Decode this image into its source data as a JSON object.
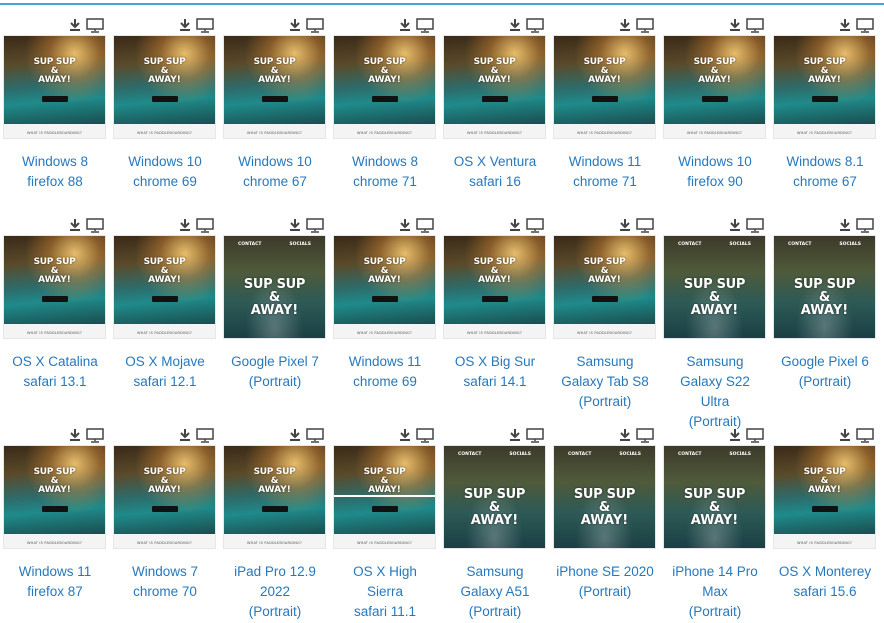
{
  "grid": {
    "hero_line1": "SUP SUP",
    "hero_amp": "&",
    "hero_line2": "AWAY!",
    "strip_text": "WHAT IS PADDLEBOARDING?",
    "nav_contact": "CONTACT",
    "nav_socials": "SOCIALS"
  },
  "rows": [
    [
      {
        "label": "Windows 8\nfirefox 88",
        "portrait": false
      },
      {
        "label": "Windows 10\nchrome 69",
        "portrait": false
      },
      {
        "label": "Windows 10\nchrome 67",
        "portrait": false
      },
      {
        "label": "Windows 8\nchrome 71",
        "portrait": false
      },
      {
        "label": "OS X Ventura\nsafari 16",
        "portrait": false
      },
      {
        "label": "Windows 11\nchrome 71",
        "portrait": false
      },
      {
        "label": "Windows 10\nfirefox 90",
        "portrait": false
      },
      {
        "label": "Windows 8.1\nchrome 67",
        "portrait": false
      }
    ],
    [
      {
        "label": "OS X Catalina\nsafari 13.1",
        "portrait": false
      },
      {
        "label": "OS X Mojave\nsafari 12.1",
        "portrait": false
      },
      {
        "label": "Google Pixel 7\n(Portrait)",
        "portrait": true
      },
      {
        "label": "Windows 11\nchrome 69",
        "portrait": false
      },
      {
        "label": "OS X Big Sur\nsafari 14.1",
        "portrait": false
      },
      {
        "label": "Samsung\nGalaxy Tab S8\n(Portrait)",
        "portrait": false
      },
      {
        "label": "Samsung\nGalaxy S22\nUltra\n(Portrait)",
        "portrait": true
      },
      {
        "label": "Google Pixel 6\n(Portrait)",
        "portrait": true
      }
    ],
    [
      {
        "label": "Windows 11\nfirefox 87",
        "portrait": false
      },
      {
        "label": "Windows 7\nchrome 70",
        "portrait": false
      },
      {
        "label": "iPad Pro 12.9\n2022\n(Portrait)",
        "portrait": false
      },
      {
        "label": "OS X High\nSierra\nsafari 11.1",
        "portrait": false,
        "split": true
      },
      {
        "label": "Samsung\nGalaxy A51\n(Portrait)",
        "portrait": true
      },
      {
        "label": "iPhone SE 2020\n(Portrait)",
        "portrait": true
      },
      {
        "label": "iPhone 14 Pro\nMax\n(Portrait)",
        "portrait": true
      },
      {
        "label": "OS X Monterey\nsafari 15.6",
        "portrait": false
      }
    ]
  ],
  "icons": [
    "download-icon",
    "monitor-icon"
  ],
  "colors": {
    "label": "#2678bd",
    "accent_line": "#4aa3d6"
  }
}
